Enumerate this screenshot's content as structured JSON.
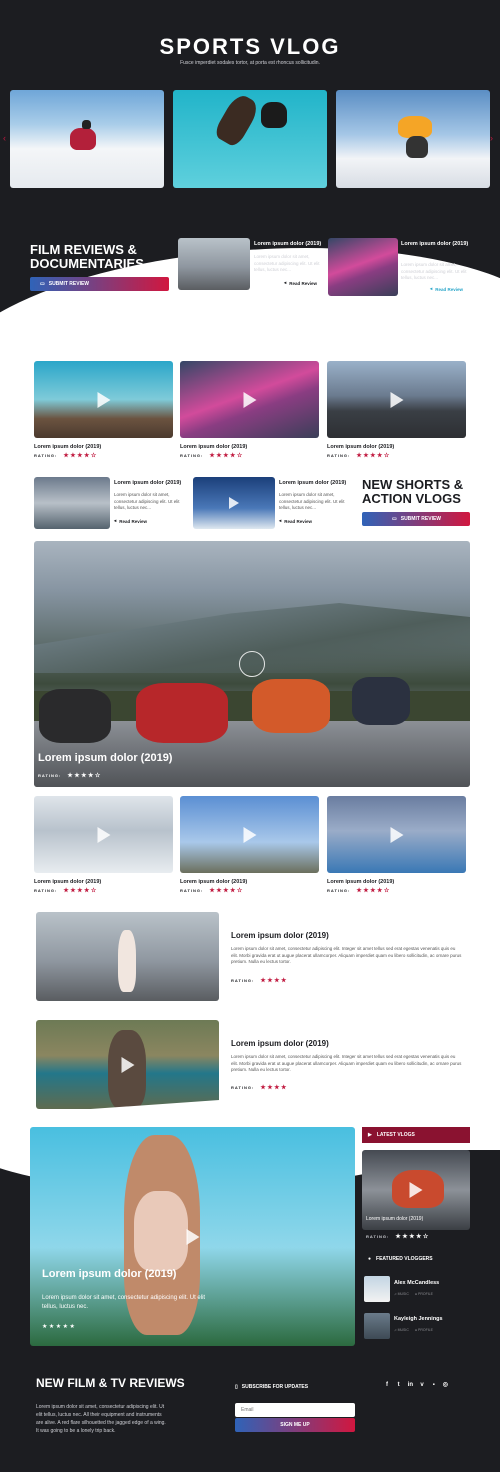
{
  "hero": {
    "title": "SPORTS VLOG",
    "subtitle": "Fusce imperdiet sodales tortor, at porta est rhoncus sollicitudin."
  },
  "carousel": {
    "prev_icon": "chevron-left-icon",
    "next_icon": "chevron-right-icon",
    "prev_glyph": "‹",
    "next_glyph": "›"
  },
  "film_reviews": {
    "title": "FILM REVIEWS & DOCUMENTARIES",
    "button": "SUBMIT REVIEW",
    "items": [
      {
        "title": "Lorem ipsum dolor (2019)",
        "text": "Lorem ipsum dolor sit amet, consectetur adipiscing elit. Ut elit tellus, luctus nec...",
        "read": "Read Review"
      },
      {
        "title": "Lorem ipsum dolor (2019)",
        "text": "Lorem ipsum dolor sit amet, consectetur adipiscing elit. Ut elit tellus, luctus nec...",
        "read": "Read Review"
      }
    ]
  },
  "grid1": [
    {
      "title": "Lorem ipsum dolor (2019)",
      "rating_label": "RATING:",
      "stars": "★★★★☆"
    },
    {
      "title": "Lorem ipsum dolor (2019)",
      "rating_label": "RATING:",
      "stars": "★★★★☆"
    },
    {
      "title": "Lorem ipsum dolor (2019)",
      "rating_label": "RATING:",
      "stars": "★★★★☆"
    }
  ],
  "mid_cards": [
    {
      "title": "Lorem ipsum dolor (2019)",
      "text": "Lorem ipsum dolor sit amet, consectetur adipiscing elit. Ut elit tellus, luctus nec...",
      "read": "Read Review"
    },
    {
      "title": "Lorem ipsum dolor (2019)",
      "text": "Lorem ipsum dolor sit amet, consectetur adipiscing elit. Ut elit tellus, luctus nec...",
      "read": "Read Review"
    }
  ],
  "shorts": {
    "title": "NEW SHORTS & ACTION VLOGS",
    "button": "SUBMIT REVIEW"
  },
  "featured": {
    "title": "Lorem ipsum dolor (2019)",
    "rating_label": "RATING:",
    "stars": "★★★★☆"
  },
  "grid2": [
    {
      "title": "Lorem ipsum dolor (2019)",
      "rating_label": "RATING:",
      "stars": "★★★★☆"
    },
    {
      "title": "Lorem ipsum dolor (2019)",
      "rating_label": "RATING:",
      "stars": "★★★★☆"
    },
    {
      "title": "Lorem ipsum dolor (2019)",
      "rating_label": "RATING:",
      "stars": "★★★★☆"
    }
  ],
  "articles": [
    {
      "title": "Lorem ipsum dolor (2019)",
      "text": "Lorem ipsum dolor sit amet, consectetur adipiscing elit. Integer sit amet tellus sed erat egestas venenatis quis eu elit. Morbi gravida erat ut augue placerat ullamcorper. Aliquam imperdiet quam eu libero sollicitudin, ac ornare purus pretium. Nulla eu lectus tortor.",
      "rating_label": "RATING:",
      "stars": "★★★★"
    },
    {
      "title": "Lorem ipsum dolor (2019)",
      "text": "Lorem ipsum dolor sit amet, consectetur adipiscing elit. Integer sit amet tellus sed erat egestas venenatis quis eu elit. Morbi gravida erat ut augue placerat ullamcorper. Aliquam imperdiet quam eu libero sollicitudin, ac ornare purus pretium. Nulla eu lectus tortor.",
      "rating_label": "RATING:",
      "stars": "★★★★"
    }
  ],
  "big_feature": {
    "title": "Lorem ipsum dolor (2019)",
    "text": "Lorem ipsum dolor sit amet, consectetur adipiscing elit. Ut elit tellus, luctus nec.",
    "stars": "★★★★★"
  },
  "latest": {
    "header": "LATEST VLOGS",
    "card_title": "Lorem ipsum dolor (2019)",
    "rating_label": "RATING:",
    "stars": "★★★★☆"
  },
  "vloggers": {
    "header": "FEATURED VLOGGERS",
    "people": [
      {
        "name": "Alex McCandless",
        "music": "MUSIC",
        "profile": "PROFILE"
      },
      {
        "name": "Kayleigh Jennings",
        "music": "MUSIC",
        "profile": "PROFILE"
      }
    ]
  },
  "footer": {
    "title": "NEW FILM & TV REVIEWS",
    "text": "Lorem ipsum dolor sit amet, consectetur adipiscing elit. Ut elit tellus, luctus nec. All their equipment and instruments are alive. A red flare silhouetted the jagged edge of a wing. It was going to be a lonely trip back.",
    "subscribe_label": "SUBSCRIBE FOR UPDATES",
    "email_placeholder": "Email",
    "signup": "SIGN ME UP",
    "social": [
      "f",
      "t",
      "in",
      "v",
      "▪",
      "◎"
    ]
  },
  "colors": {
    "dark": "#1c1d21",
    "accent": "#c0183e",
    "blue": "#2f63b8"
  }
}
